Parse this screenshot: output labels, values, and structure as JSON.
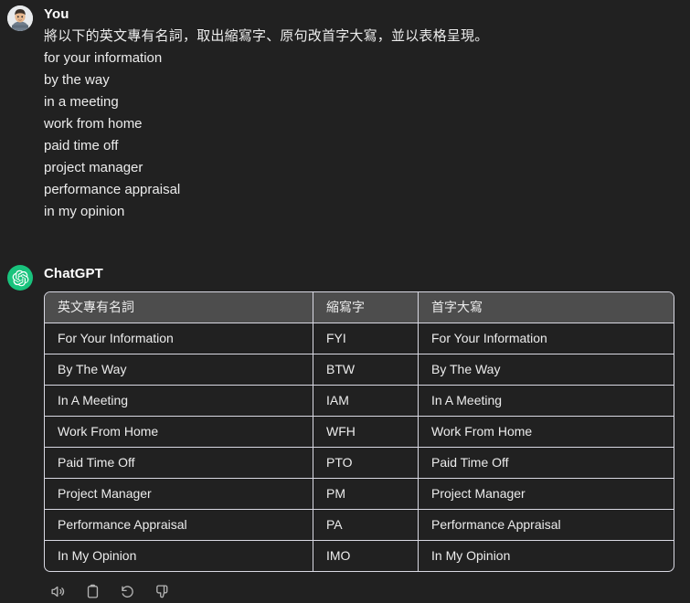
{
  "theme": {
    "background": "#212121",
    "text": "#ececec",
    "table_border": "#d9d9e3",
    "table_header_bg": "#4d4d4d",
    "assistant_accent": "#19c37d",
    "icon_color": "#b4b4b4"
  },
  "user_message": {
    "author": "You",
    "avatar_icon": "user-photo-avatar",
    "prompt": "將以下的英文專有名詞，取出縮寫字、原句改首字大寫，並以表格呈現。",
    "terms": [
      "for your information",
      "by the way",
      "in a meeting",
      "work from home",
      "paid time off",
      "project manager",
      "performance appraisal",
      "in my opinion"
    ]
  },
  "assistant_message": {
    "author": "ChatGPT",
    "avatar_icon": "openai-logo-icon",
    "table": {
      "headers": [
        "英文專有名詞",
        "縮寫字",
        "首字大寫"
      ],
      "rows": [
        [
          "For Your Information",
          "FYI",
          "For Your Information"
        ],
        [
          "By The Way",
          "BTW",
          "By The Way"
        ],
        [
          "In A Meeting",
          "IAM",
          "In A Meeting"
        ],
        [
          "Work From Home",
          "WFH",
          "Work From Home"
        ],
        [
          "Paid Time Off",
          "PTO",
          "Paid Time Off"
        ],
        [
          "Project Manager",
          "PM",
          "Project Manager"
        ],
        [
          "Performance Appraisal",
          "PA",
          "Performance Appraisal"
        ],
        [
          "In My Opinion",
          "IMO",
          "In My Opinion"
        ]
      ]
    },
    "actions": [
      {
        "name": "read-aloud-button",
        "icon": "speaker-icon",
        "label": "Read aloud"
      },
      {
        "name": "copy-button",
        "icon": "clipboard-icon",
        "label": "Copy"
      },
      {
        "name": "regenerate-button",
        "icon": "refresh-icon",
        "label": "Regenerate"
      },
      {
        "name": "dislike-button",
        "icon": "thumbs-down-icon",
        "label": "Bad response"
      }
    ]
  }
}
